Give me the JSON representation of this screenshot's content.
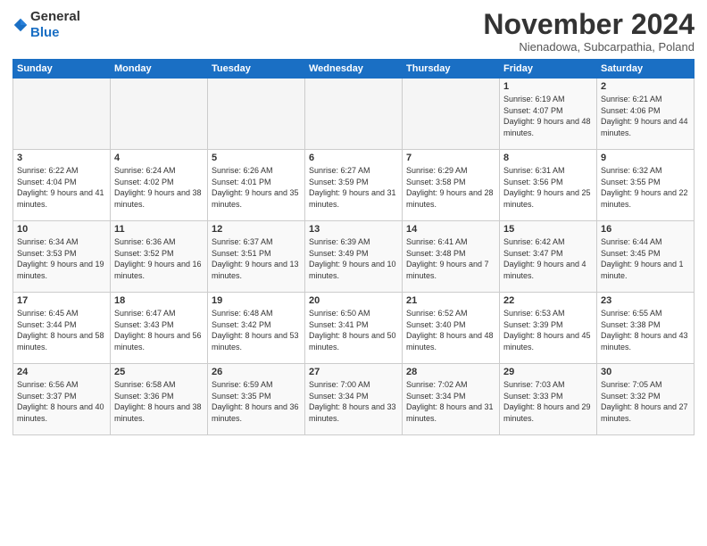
{
  "logo": {
    "general": "General",
    "blue": "Blue"
  },
  "header": {
    "month": "November 2024",
    "location": "Nienadowa, Subcarpathia, Poland"
  },
  "weekdays": [
    "Sunday",
    "Monday",
    "Tuesday",
    "Wednesday",
    "Thursday",
    "Friday",
    "Saturday"
  ],
  "weeks": [
    [
      {
        "day": "",
        "info": ""
      },
      {
        "day": "",
        "info": ""
      },
      {
        "day": "",
        "info": ""
      },
      {
        "day": "",
        "info": ""
      },
      {
        "day": "",
        "info": ""
      },
      {
        "day": "1",
        "info": "Sunrise: 6:19 AM\nSunset: 4:07 PM\nDaylight: 9 hours and 48 minutes."
      },
      {
        "day": "2",
        "info": "Sunrise: 6:21 AM\nSunset: 4:06 PM\nDaylight: 9 hours and 44 minutes."
      }
    ],
    [
      {
        "day": "3",
        "info": "Sunrise: 6:22 AM\nSunset: 4:04 PM\nDaylight: 9 hours and 41 minutes."
      },
      {
        "day": "4",
        "info": "Sunrise: 6:24 AM\nSunset: 4:02 PM\nDaylight: 9 hours and 38 minutes."
      },
      {
        "day": "5",
        "info": "Sunrise: 6:26 AM\nSunset: 4:01 PM\nDaylight: 9 hours and 35 minutes."
      },
      {
        "day": "6",
        "info": "Sunrise: 6:27 AM\nSunset: 3:59 PM\nDaylight: 9 hours and 31 minutes."
      },
      {
        "day": "7",
        "info": "Sunrise: 6:29 AM\nSunset: 3:58 PM\nDaylight: 9 hours and 28 minutes."
      },
      {
        "day": "8",
        "info": "Sunrise: 6:31 AM\nSunset: 3:56 PM\nDaylight: 9 hours and 25 minutes."
      },
      {
        "day": "9",
        "info": "Sunrise: 6:32 AM\nSunset: 3:55 PM\nDaylight: 9 hours and 22 minutes."
      }
    ],
    [
      {
        "day": "10",
        "info": "Sunrise: 6:34 AM\nSunset: 3:53 PM\nDaylight: 9 hours and 19 minutes."
      },
      {
        "day": "11",
        "info": "Sunrise: 6:36 AM\nSunset: 3:52 PM\nDaylight: 9 hours and 16 minutes."
      },
      {
        "day": "12",
        "info": "Sunrise: 6:37 AM\nSunset: 3:51 PM\nDaylight: 9 hours and 13 minutes."
      },
      {
        "day": "13",
        "info": "Sunrise: 6:39 AM\nSunset: 3:49 PM\nDaylight: 9 hours and 10 minutes."
      },
      {
        "day": "14",
        "info": "Sunrise: 6:41 AM\nSunset: 3:48 PM\nDaylight: 9 hours and 7 minutes."
      },
      {
        "day": "15",
        "info": "Sunrise: 6:42 AM\nSunset: 3:47 PM\nDaylight: 9 hours and 4 minutes."
      },
      {
        "day": "16",
        "info": "Sunrise: 6:44 AM\nSunset: 3:45 PM\nDaylight: 9 hours and 1 minute."
      }
    ],
    [
      {
        "day": "17",
        "info": "Sunrise: 6:45 AM\nSunset: 3:44 PM\nDaylight: 8 hours and 58 minutes."
      },
      {
        "day": "18",
        "info": "Sunrise: 6:47 AM\nSunset: 3:43 PM\nDaylight: 8 hours and 56 minutes."
      },
      {
        "day": "19",
        "info": "Sunrise: 6:48 AM\nSunset: 3:42 PM\nDaylight: 8 hours and 53 minutes."
      },
      {
        "day": "20",
        "info": "Sunrise: 6:50 AM\nSunset: 3:41 PM\nDaylight: 8 hours and 50 minutes."
      },
      {
        "day": "21",
        "info": "Sunrise: 6:52 AM\nSunset: 3:40 PM\nDaylight: 8 hours and 48 minutes."
      },
      {
        "day": "22",
        "info": "Sunrise: 6:53 AM\nSunset: 3:39 PM\nDaylight: 8 hours and 45 minutes."
      },
      {
        "day": "23",
        "info": "Sunrise: 6:55 AM\nSunset: 3:38 PM\nDaylight: 8 hours and 43 minutes."
      }
    ],
    [
      {
        "day": "24",
        "info": "Sunrise: 6:56 AM\nSunset: 3:37 PM\nDaylight: 8 hours and 40 minutes."
      },
      {
        "day": "25",
        "info": "Sunrise: 6:58 AM\nSunset: 3:36 PM\nDaylight: 8 hours and 38 minutes."
      },
      {
        "day": "26",
        "info": "Sunrise: 6:59 AM\nSunset: 3:35 PM\nDaylight: 8 hours and 36 minutes."
      },
      {
        "day": "27",
        "info": "Sunrise: 7:00 AM\nSunset: 3:34 PM\nDaylight: 8 hours and 33 minutes."
      },
      {
        "day": "28",
        "info": "Sunrise: 7:02 AM\nSunset: 3:34 PM\nDaylight: 8 hours and 31 minutes."
      },
      {
        "day": "29",
        "info": "Sunrise: 7:03 AM\nSunset: 3:33 PM\nDaylight: 8 hours and 29 minutes."
      },
      {
        "day": "30",
        "info": "Sunrise: 7:05 AM\nSunset: 3:32 PM\nDaylight: 8 hours and 27 minutes."
      }
    ]
  ]
}
